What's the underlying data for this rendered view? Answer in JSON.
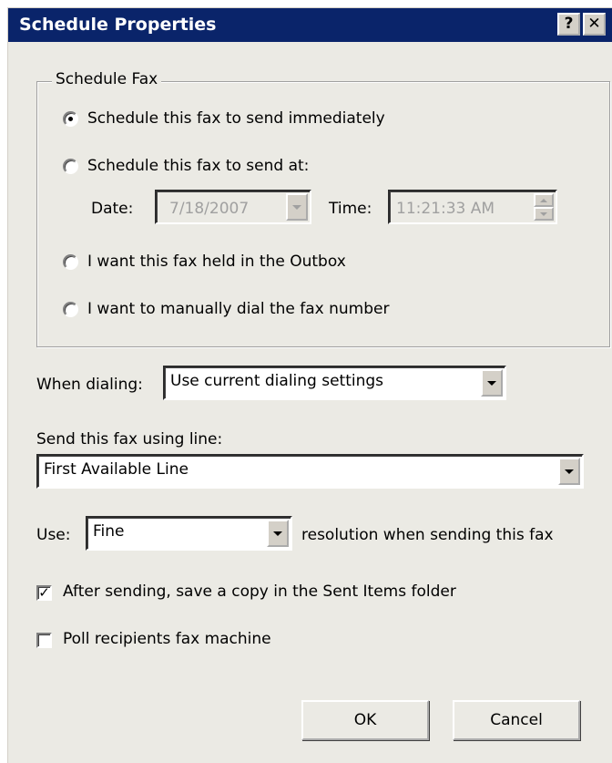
{
  "window": {
    "title": "Schedule Properties",
    "help_glyph": "?",
    "close_glyph": "✕"
  },
  "schedule_group": {
    "label": "Schedule Fax",
    "options": [
      {
        "label": "Schedule this fax to send immediately",
        "selected": true
      },
      {
        "label": "Schedule this fax to send at:",
        "selected": false
      },
      {
        "label": "I want this fax held in the Outbox",
        "selected": false
      },
      {
        "label": "I want to manually dial the fax number",
        "selected": false
      }
    ],
    "date_label": "Date:",
    "date_value": "7/18/2007",
    "time_label": "Time:",
    "time_value": "11:21:33 AM"
  },
  "dialing": {
    "label": "When dialing:",
    "value": "Use current dialing settings"
  },
  "line": {
    "label": "Send this fax using line:",
    "value": "First Available Line"
  },
  "resolution": {
    "prefix": "Use:",
    "value": "Fine",
    "suffix": "resolution when sending this fax"
  },
  "checkboxes": [
    {
      "label": "After sending, save a copy in the Sent Items folder",
      "checked": true,
      "mark": "✓"
    },
    {
      "label": "Poll recipients fax machine",
      "checked": false,
      "mark": ""
    }
  ],
  "buttons": {
    "ok": "OK",
    "cancel": "Cancel"
  },
  "colors": {
    "titlebar": "#0a246a",
    "dialog_bg": "#ebeae4"
  }
}
